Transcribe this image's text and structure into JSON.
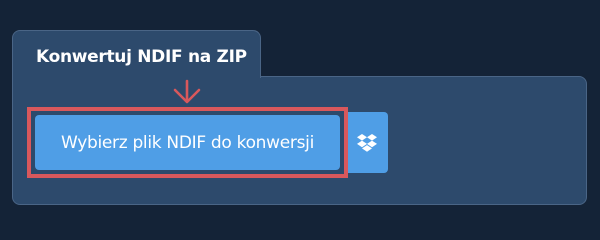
{
  "converter": {
    "title": "Konwertuj NDIF na ZIP",
    "choose_file_label": "Wybierz plik NDIF do konwersji",
    "dropbox_icon": "dropbox-icon",
    "arrow_icon": "arrow-down-icon"
  },
  "colors": {
    "page_background": "#142337",
    "panel_background": "#2d4a6c",
    "button_background": "#4f9ee6",
    "highlight_border": "#d9585c"
  }
}
